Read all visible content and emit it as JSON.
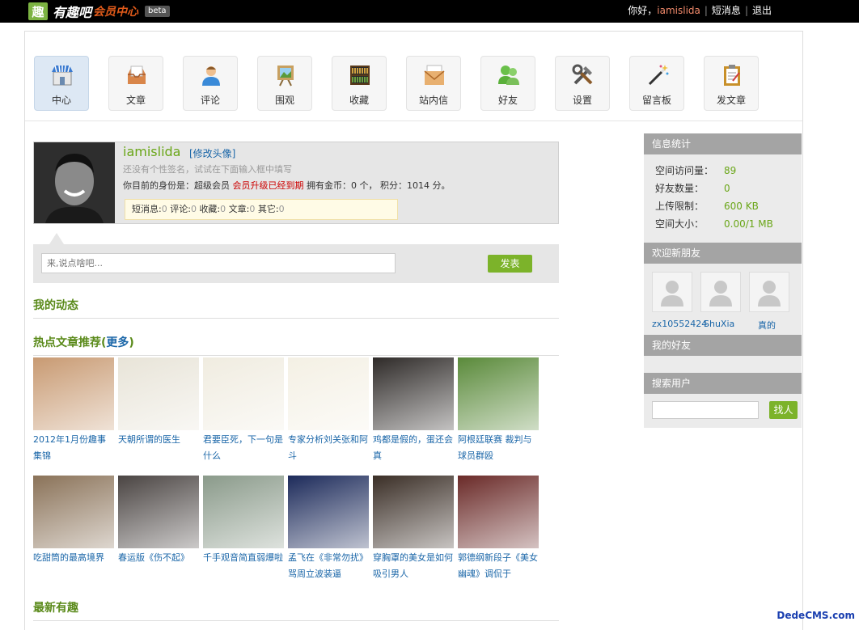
{
  "topbar": {
    "logo_mark": "趣",
    "logo_name": "有趣吧",
    "logo_sub": "会员中心",
    "logo_badge": "beta",
    "greeting": "你好，",
    "username": "iamislida",
    "messages": "短消息",
    "logout": "退出"
  },
  "nav": [
    {
      "label": "中心",
      "icon": "store-icon",
      "active": true
    },
    {
      "label": "文章",
      "icon": "inbox-icon"
    },
    {
      "label": "评论",
      "icon": "user-icon"
    },
    {
      "label": "围观",
      "icon": "picture-icon"
    },
    {
      "label": "收藏",
      "icon": "bookshelf-icon"
    },
    {
      "label": "站内信",
      "icon": "mail-icon"
    },
    {
      "label": "好友",
      "icon": "friends-icon"
    },
    {
      "label": "设置",
      "icon": "tools-icon"
    },
    {
      "label": "留言板",
      "icon": "magic-wand-icon"
    },
    {
      "label": "发文章",
      "icon": "clipboard-icon"
    }
  ],
  "profile": {
    "username": "iamislida",
    "edit_avatar": "[修改头像]",
    "signature": "还没有个性签名，试试在下面输入框中填写",
    "status_prefix": "你目前的身份是：超级会员",
    "status_warn": "会员升级已经到期",
    "status_suffix": "拥有金币：0 个， 积分：1014 分。",
    "counts": [
      {
        "label": "短消息:",
        "value": "0"
      },
      {
        "label": "评论:",
        "value": "0"
      },
      {
        "label": "收藏:",
        "value": "0"
      },
      {
        "label": "文章:",
        "value": "0"
      },
      {
        "label": "其它:",
        "value": "0"
      }
    ]
  },
  "post": {
    "placeholder": "来,说点啥吧...",
    "button": "发表"
  },
  "sections": {
    "my_activity": "我的动态",
    "hot_title": "热点文章推荐(",
    "hot_more": "更多",
    "hot_close": ")",
    "latest": "最新有趣"
  },
  "articles": [
    {
      "title": "2012年1月份趣事集锦",
      "thumb_color": "#c89a72"
    },
    {
      "title": "天朝所谓的医生",
      "thumb_color": "#e8e4d8"
    },
    {
      "title": "君要臣死，下一句是什么",
      "thumb_color": "#f0ece0"
    },
    {
      "title": "专家分析刘关张和阿斗",
      "thumb_color": "#f4f0e4"
    },
    {
      "title": "鸡都是假的，蛋还会真",
      "thumb_color": "#2e2a28"
    },
    {
      "title": "阿根廷联赛 裁判与球员群殴",
      "thumb_color": "#5a8a3a"
    },
    {
      "title": "吃甜筒的最高境界",
      "thumb_color": "#8a7258"
    },
    {
      "title": "春运版《伤不起》",
      "thumb_color": "#4a4442"
    },
    {
      "title": "千手观音简直弱爆啦",
      "thumb_color": "#8a9a8a"
    },
    {
      "title": "孟飞在《非常勿扰》骂周立波装逼",
      "thumb_color": "#1c2a5a"
    },
    {
      "title": "穿胸罩的美女是如何吸引男人",
      "thumb_color": "#3a2e26"
    },
    {
      "title": "郭德纲新段子《美女幽魂》调侃于",
      "thumb_color": "#6a2a28"
    }
  ],
  "sidebar": {
    "stats_title": "信息统计",
    "stats": [
      {
        "label": "空间访问量：",
        "value": "89"
      },
      {
        "label": "好友数量：",
        "value": "0"
      },
      {
        "label": "上传限制：",
        "value": "600 KB"
      },
      {
        "label": "空间大小：",
        "value": "0.00/1 MB"
      }
    ],
    "welcome_title": "欢迎新朋友",
    "new_friends": [
      "zx10552424",
      "ShuXia",
      "真的"
    ],
    "my_friends_title": "我的好友",
    "search_title": "搜索用户",
    "search_button": "找人"
  },
  "watermark": "DedeCMS.com"
}
